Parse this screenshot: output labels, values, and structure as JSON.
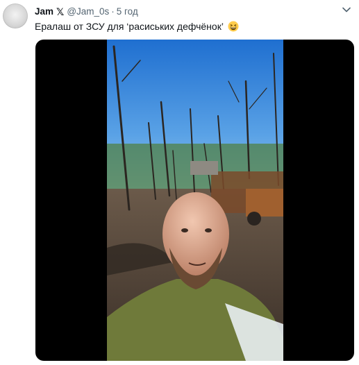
{
  "tweet": {
    "display_name": "Jam",
    "badge": "𝕏",
    "handle": "@Jam_0s",
    "separator": "·",
    "time": "5 год",
    "text": "Ералаш от ЗСУ для ‘расиських дефчёнок’",
    "emoji": "grinning-squinting-face-emoji"
  },
  "icons": {
    "more": "chevron-down-icon"
  },
  "colors": {
    "text_primary": "#0f1419",
    "text_secondary": "#536471",
    "media_background": "#000000"
  }
}
